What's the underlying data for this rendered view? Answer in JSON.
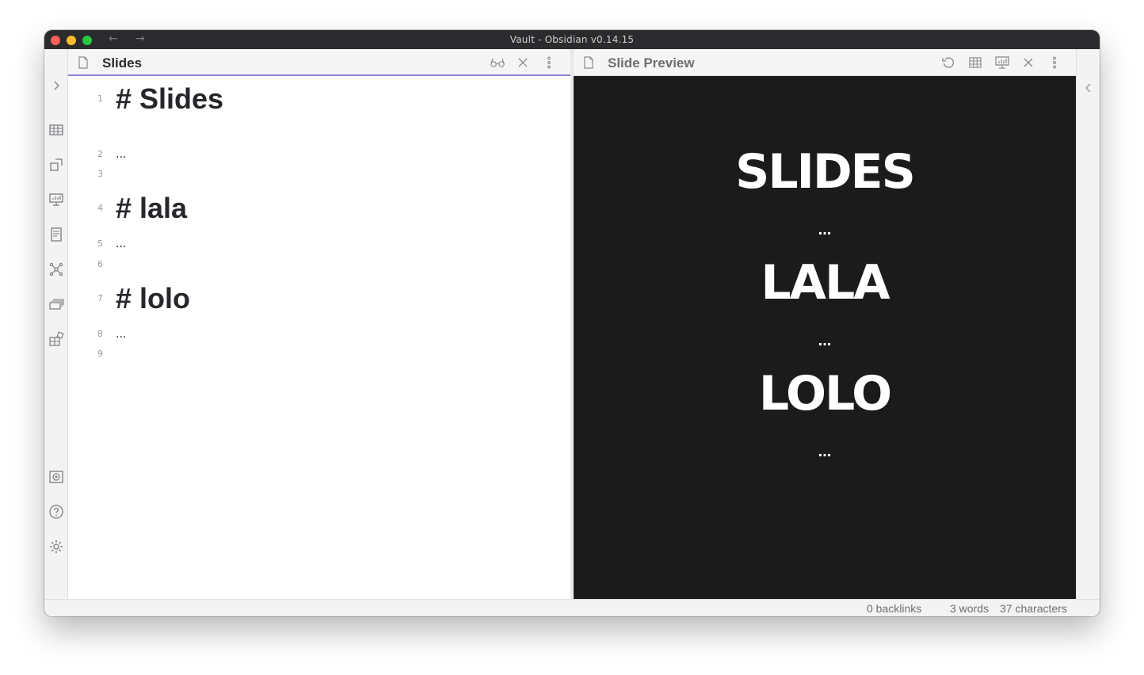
{
  "window": {
    "title": "Vault - Obsidian v0.14.15"
  },
  "titlebar": {
    "back_icon": "arrow-left-icon",
    "forward_icon": "arrow-right-icon"
  },
  "left_ribbon": {
    "expand_icon": "chevron-right-icon",
    "top_icons": [
      "table-icon",
      "shapes-icon",
      "presentation-icon",
      "document-icon",
      "graph-icon",
      "cards-icon",
      "blocks-icon"
    ],
    "bottom_icons": [
      "vault-icon",
      "help-icon",
      "settings-icon"
    ]
  },
  "editor_pane": {
    "tab_title": "Slides",
    "tab_icon": "file-icon",
    "actions": [
      "reading-view-icon",
      "close-icon",
      "more-options-icon"
    ],
    "lines": [
      {
        "no": "1",
        "text": "# Slides",
        "style": "h1"
      },
      {
        "no": "2",
        "text": "...",
        "style": "p"
      },
      {
        "no": "3",
        "text": "",
        "style": "p"
      },
      {
        "no": "4",
        "text": "# lala",
        "style": "h1"
      },
      {
        "no": "5",
        "text": "...",
        "style": "p"
      },
      {
        "no": "6",
        "text": "",
        "style": "p"
      },
      {
        "no": "7",
        "text": "# lolo",
        "style": "h1"
      },
      {
        "no": "8",
        "text": "...",
        "style": "p"
      },
      {
        "no": "9",
        "text": "",
        "style": "p"
      }
    ]
  },
  "preview_pane": {
    "tab_title": "Slide Preview",
    "tab_icon": "file-icon",
    "actions": [
      "reload-icon",
      "grid-icon",
      "presentation-icon",
      "close-icon",
      "more-options-icon"
    ],
    "background": "#1b1b1b",
    "slide_lines": [
      {
        "text": "SLIDES",
        "style": "h"
      },
      {
        "text": "...",
        "style": "p"
      },
      {
        "text": "LALA",
        "style": "h"
      },
      {
        "text": "...",
        "style": "p"
      },
      {
        "text": "LOLO",
        "style": "h"
      },
      {
        "text": "...",
        "style": "p"
      }
    ]
  },
  "right_sidebar": {
    "collapse_icon": "chevron-left-icon"
  },
  "status_bar": {
    "backlinks": "0 backlinks",
    "words": "3 words",
    "characters": "37 characters"
  },
  "colors": {
    "accent": "#8e82d6",
    "titlebar": "#2b2b2d"
  }
}
